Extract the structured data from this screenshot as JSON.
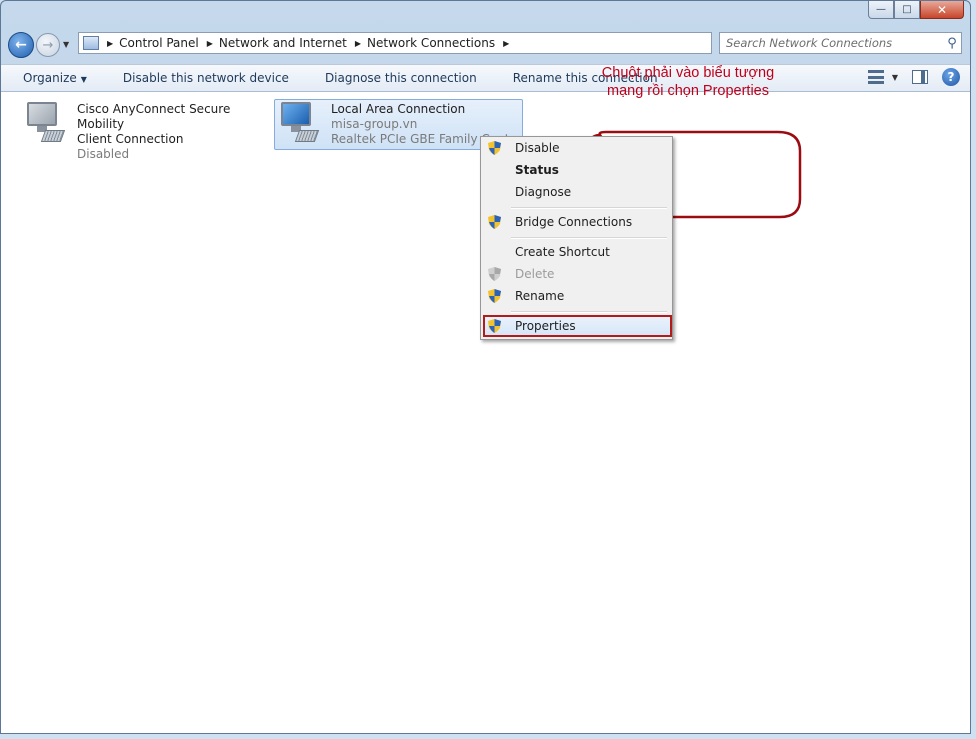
{
  "window": {
    "caption_buttons": [
      "minimize",
      "maximize",
      "close"
    ]
  },
  "nav": {
    "back_icon": "back-arrow-icon",
    "forward_icon": "forward-arrow-icon",
    "breadcrumbs": [
      "Control Panel",
      "Network and Internet",
      "Network Connections"
    ],
    "search_placeholder": "Search Network Connections"
  },
  "toolbar": {
    "organize": "Organize",
    "disable": "Disable this network device",
    "diagnose": "Diagnose this connection",
    "rename": "Rename this connection"
  },
  "connections": [
    {
      "name_line1": "Cisco AnyConnect Secure Mobility",
      "name_line2": "Client Connection",
      "status": "Disabled",
      "selected": false
    },
    {
      "name_line1": "Local Area Connection",
      "network": "misa-group.vn",
      "adapter": "Realtek PCIe GBE Family Controller",
      "selected": true
    }
  ],
  "context_menu": {
    "items": [
      {
        "label": "Disable",
        "shield": true
      },
      {
        "label": "Status",
        "bold": true
      },
      {
        "label": "Diagnose"
      },
      {
        "label": "Bridge Connections",
        "shield": true
      },
      {
        "label": "Create Shortcut"
      },
      {
        "label": "Delete",
        "shield": true,
        "disabled": true
      },
      {
        "label": "Rename",
        "shield": true
      },
      {
        "label": "Properties",
        "shield": true,
        "highlighted": true
      }
    ]
  },
  "callout": {
    "line1": "Chuột phải vào biểu tượng",
    "line2": "mạng rồi chọn Properties",
    "color": "#c0001b"
  }
}
